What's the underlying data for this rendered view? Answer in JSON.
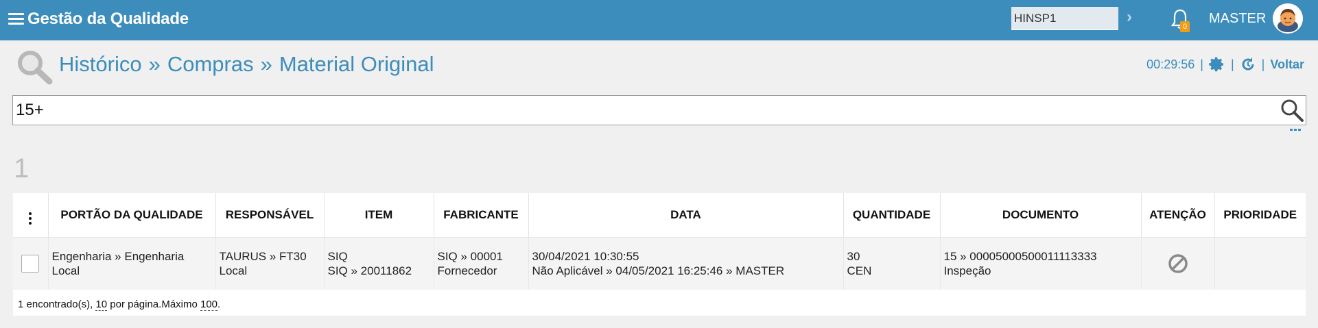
{
  "topbar": {
    "app_title": "Gestão da Qualidade",
    "unit_value": "HINSP1",
    "notifications_count": "0",
    "user_name": "MASTER",
    "color": "#3c8dbc"
  },
  "header": {
    "breadcrumb": [
      "Histórico",
      "Compras",
      "Material Original"
    ],
    "separator": "»",
    "clock": "00:29:56",
    "divider": "|",
    "back_label": "Voltar"
  },
  "search": {
    "value": "15+"
  },
  "results": {
    "count": "1"
  },
  "table": {
    "columns": [
      "PORTÃO DA QUALIDADE",
      "RESPONSÁVEL",
      "ITEM",
      "FABRICANTE",
      "DATA",
      "QUANTIDADE",
      "DOCUMENTO",
      "ATENÇÃO",
      "PRIORIDADE"
    ],
    "rows": [
      {
        "portao": [
          "Engenharia » Engenharia",
          "Local"
        ],
        "responsavel": [
          "TAURUS » FT30",
          "Local"
        ],
        "item": [
          "SIQ",
          "SIQ » 20011862"
        ],
        "fabricante": [
          "SIQ » 00001",
          "Fornecedor"
        ],
        "data": [
          "30/04/2021 10:30:55",
          "Não Aplicável » 04/05/2021 16:25:46 » MASTER"
        ],
        "quantidade": [
          "30",
          "CEN"
        ],
        "documento": [
          "15 » 00005000500011113333",
          "Inspeção"
        ],
        "atencao_icon": "block-icon",
        "prioridade": ""
      }
    ]
  },
  "footer": {
    "found_text": "1 encontrado(s), ",
    "per_page": "10",
    "per_page_text": " por página.Máximo ",
    "max": "100",
    "end": "."
  }
}
